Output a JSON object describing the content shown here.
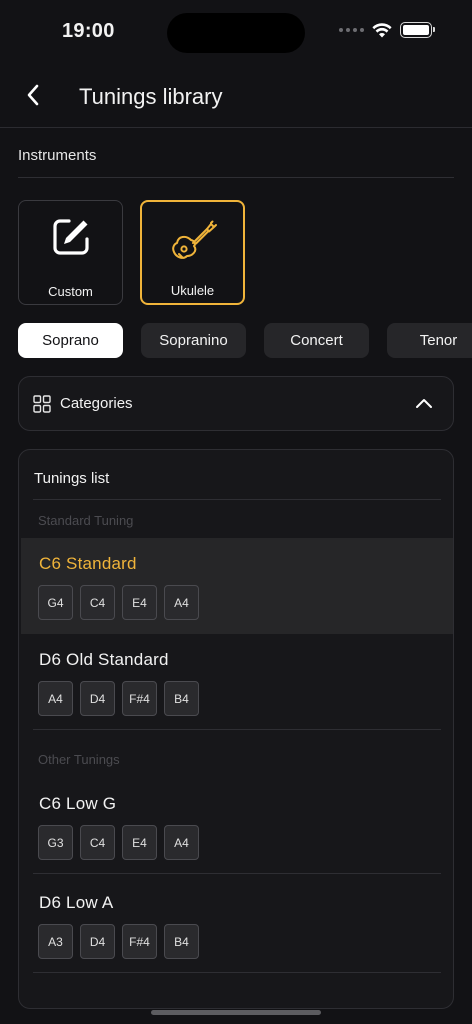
{
  "status": {
    "time": "19:00"
  },
  "nav": {
    "title": "Tunings library"
  },
  "instruments": {
    "label": "Instruments",
    "items": [
      {
        "label": "Custom",
        "icon": "edit-icon",
        "selected": false
      },
      {
        "label": "Ukulele",
        "icon": "ukulele-icon",
        "selected": true
      }
    ]
  },
  "sizes": {
    "items": [
      {
        "label": "Soprano",
        "active": true
      },
      {
        "label": "Sopranino",
        "active": false
      },
      {
        "label": "Concert",
        "active": false
      },
      {
        "label": "Tenor",
        "active": false
      }
    ]
  },
  "categories": {
    "label": "Categories",
    "expanded": true
  },
  "tunings": {
    "title": "Tunings list",
    "groups": [
      {
        "header": "Standard Tuning",
        "items": [
          {
            "name": "C6 Standard",
            "notes": [
              "G4",
              "C4",
              "E4",
              "A4"
            ],
            "selected": true
          },
          {
            "name": "D6 Old Standard",
            "notes": [
              "A4",
              "D4",
              "F#4",
              "B4"
            ],
            "selected": false
          }
        ]
      },
      {
        "header": "Other Tunings",
        "items": [
          {
            "name": "C6 Low G",
            "notes": [
              "G3",
              "C4",
              "E4",
              "A4"
            ],
            "selected": false
          },
          {
            "name": "D6 Low A",
            "notes": [
              "A3",
              "D4",
              "F#4",
              "B4"
            ],
            "selected": false
          }
        ]
      }
    ]
  },
  "colors": {
    "accent": "#f0b43a",
    "background": "#121215",
    "card": "#17171a"
  }
}
